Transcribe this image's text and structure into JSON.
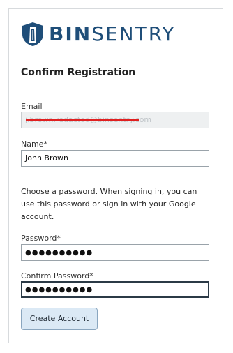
{
  "brand": {
    "part1": "BIN",
    "part2": "SENTRY"
  },
  "form": {
    "title": "Confirm Registration",
    "email_label": "Email",
    "email_value": "j.brown.redacted@binsentry.com",
    "name_label": "Name*",
    "name_value": "John Brown",
    "instructions": "Choose a password. When signing in, you can use this password or sign in with your Google account.",
    "password_label": "Password*",
    "password_value": "●●●●●●●●●●",
    "confirm_label": "Confirm Password*",
    "confirm_value": "●●●●●●●●●●",
    "submit_label": "Create Account"
  },
  "colors": {
    "brand": "#1f4e79",
    "button_bg": "#dbe9f5",
    "redaction": "#e02020"
  },
  "icons": {
    "logo": "shield-road-icon"
  }
}
